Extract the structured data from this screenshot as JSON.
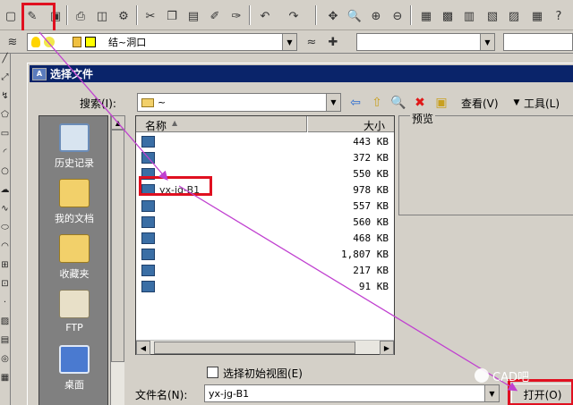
{
  "toolbar": {
    "layer_name": "结~洞口"
  },
  "dialog": {
    "title": "选择文件",
    "search_label": "搜索(I):",
    "look_in_value": "~",
    "view_label": "查看(V)",
    "tools_label": "工具(L)",
    "preview_label": "预览",
    "columns": {
      "name": "名称",
      "size": "大小"
    },
    "files": [
      {
        "name": "",
        "size": "443 KB"
      },
      {
        "name": "",
        "size": "372 KB"
      },
      {
        "name": "",
        "size": "550 KB"
      },
      {
        "name": "yx-jg-B1",
        "size": "978 KB"
      },
      {
        "name": "",
        "size": "557 KB"
      },
      {
        "name": "",
        "size": "560 KB"
      },
      {
        "name": "",
        "size": "468 KB"
      },
      {
        "name": "",
        "size": "1,807 KB"
      },
      {
        "name": "",
        "size": "217 KB"
      },
      {
        "name": "",
        "size": "91 KB"
      }
    ],
    "places": [
      "历史记录",
      "我的文档",
      "收藏夹",
      "FTP",
      "桌面"
    ],
    "initial_view_label": "选择初始视图(E)",
    "filename_label": "文件名(N):",
    "filename_value": "yx-jg-B1",
    "open_label": "打开(O)"
  },
  "watermark": "CAD吧",
  "colors": {
    "highlight": "#e01020",
    "arrow": "#c040d0",
    "titlebar": "#0a246a"
  }
}
